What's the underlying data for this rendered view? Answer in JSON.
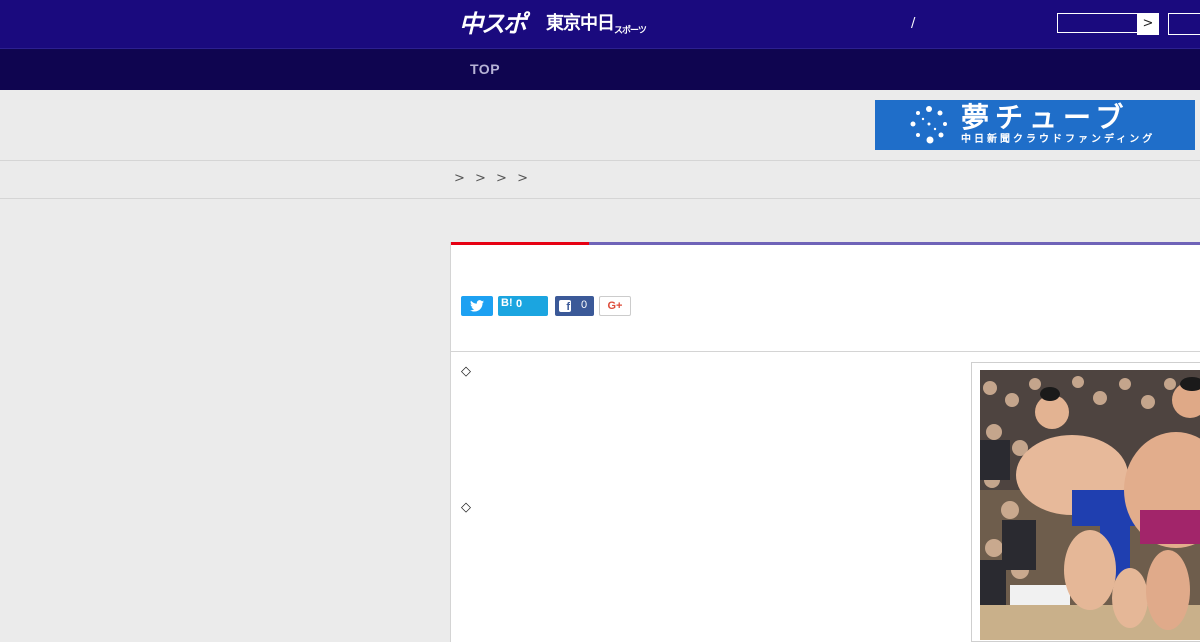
{
  "header": {
    "logo_main": "中スポ",
    "logo_sub": "東京中日",
    "logo_sub_small": "スポーツ",
    "slash": "/",
    "search_button": ">"
  },
  "nav": {
    "items": [
      {
        "label": "TOP"
      }
    ]
  },
  "banner": {
    "title": "夢チューブ",
    "subtitle": "中日新聞クラウドファンディング"
  },
  "breadcrumb": {
    "text": "> > > >"
  },
  "share": {
    "hatena_label": "B!",
    "hatena_count": "0",
    "facebook_icon_glyph": "f",
    "facebook_count": "0",
    "google_plus_label": "G+"
  },
  "article": {
    "bullets": [
      "◇",
      "◇"
    ]
  },
  "colors": {
    "header_bg": "#1a0a7e",
    "nav_bg": "#0f0550",
    "accent_red": "#e60012",
    "accent_purple": "#6f63b8",
    "banner_bg": "#1f6ec9"
  },
  "icons": {
    "twitter": "twitter-bird-icon",
    "facebook": "facebook-icon",
    "search": "chevron-right-icon"
  }
}
